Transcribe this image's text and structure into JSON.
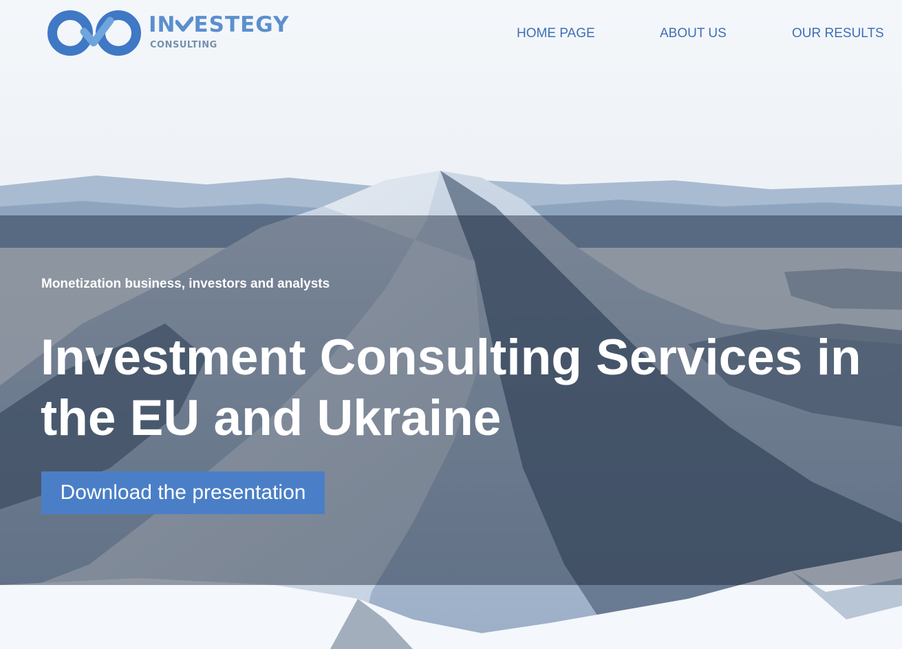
{
  "brand": {
    "name_pre": "IN",
    "name_post": "ESTEGY",
    "subtitle": "CONSULTING",
    "logo_icon": "infinity-check-icon",
    "color": "#5b8fce"
  },
  "nav": {
    "items": [
      {
        "label": "HOME PAGE"
      },
      {
        "label": "ABOUT US"
      },
      {
        "label": "OUR RESULTS"
      }
    ],
    "color": "#3e6fb5"
  },
  "hero": {
    "tagline": "Monetization business, investors and analysts",
    "headline": "Investment Consulting Services in the EU and Ukraine",
    "cta_label": "Download the presentation",
    "cta_color": "#4a7fc7",
    "background": "snowy-mountain-peak-photo"
  }
}
